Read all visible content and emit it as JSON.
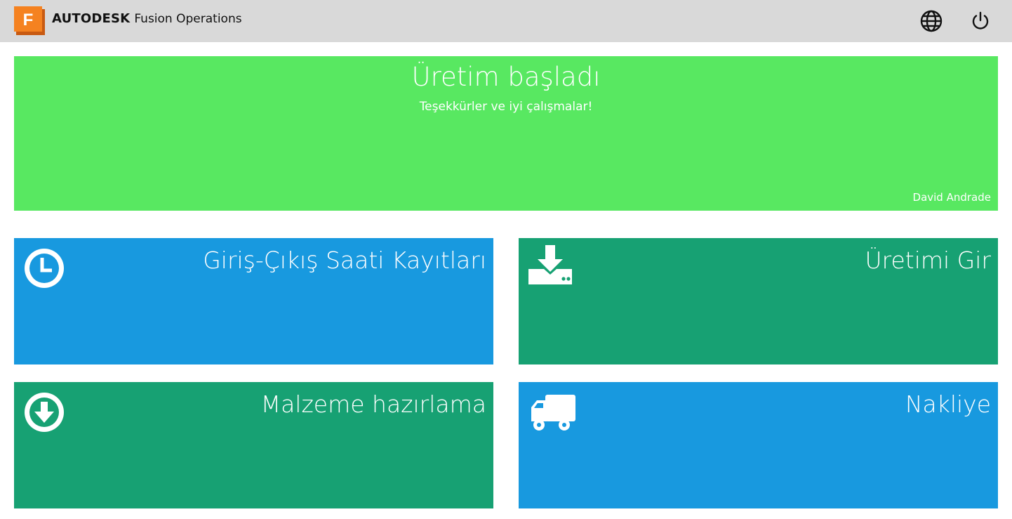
{
  "header": {
    "logo_letter": "F",
    "brand_name": "AUTODESK",
    "product_name": "Fusion Operations",
    "icons": [
      "globe-icon",
      "power-icon"
    ],
    "background": "#d9d9d9"
  },
  "banner": {
    "title": "Üretim başladı",
    "subtitle": "Teşekkürler ve iyi çalışmalar!",
    "user": "David Andrade",
    "color": "#58e861"
  },
  "tiles": [
    {
      "label": "Giriş-Çıkış Saati Kayıtları",
      "icon": "clock-icon",
      "color": "#1899df"
    },
    {
      "label": "Üretimi Gir",
      "icon": "download-drive-icon",
      "color": "#17a173"
    },
    {
      "label": "Malzeme hazırlama",
      "icon": "arrow-down-circle-icon",
      "color": "#17a173"
    },
    {
      "label": "Nakliye",
      "icon": "truck-icon",
      "color": "#1899df"
    }
  ],
  "colors": {
    "logo_orange": "#f58220",
    "logo_dark": "#c85a12"
  }
}
